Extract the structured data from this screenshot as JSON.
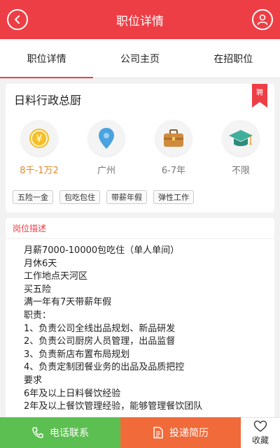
{
  "header": {
    "title": "职位详情"
  },
  "tabs": [
    {
      "label": "职位详情"
    },
    {
      "label": "公司主页"
    },
    {
      "label": "在招职位"
    }
  ],
  "job": {
    "title": "日料行政总厨",
    "badge": "聘",
    "salary": "8千-1万2",
    "city": "广州",
    "experience": "6-7年",
    "education": "不限",
    "tags": [
      "五险一金",
      "包吃包住",
      "带薪年假",
      "弹性工作"
    ]
  },
  "description": {
    "heading": "岗位描述",
    "lines": [
      "月薪7000-10000包吃住（单人单间）",
      "月休6天",
      "工作地点天河区",
      "买五险",
      "满一年有7天带薪年假",
      "职责：",
      "1、负责公司全线出品规划、新品研发",
      "2、负责公司厨房人员管理，出品监督",
      "3、负责新店布置布局规划",
      "4、负责定制团餐业务的出品及品质把控",
      "要求",
      "6年及以上日料餐饮经验",
      "2年及以上餐饮管理经验，能够管理餐饮团队"
    ]
  },
  "bottom": {
    "call_label": "电话联系",
    "apply_label": "投递简历",
    "fav_label": "收藏"
  }
}
